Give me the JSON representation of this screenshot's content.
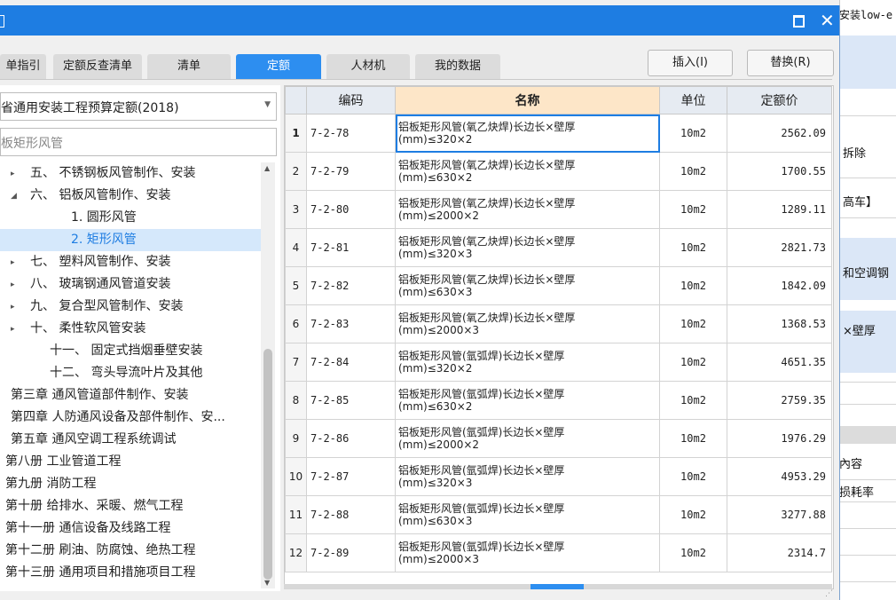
{
  "background": {
    "right_texts": [
      "安装low-e",
      "拆除",
      "高车】",
      "和空调钢",
      "×壁厚",
      "內容",
      "损耗率"
    ]
  },
  "dialog": {
    "tabs": [
      {
        "label": "单指引"
      },
      {
        "label": "定额反查清单"
      },
      {
        "label": "清单"
      },
      {
        "label": "定额"
      },
      {
        "label": "人材机"
      },
      {
        "label": "我的数据"
      }
    ],
    "insert_button": "插入(I)",
    "replace_button": "替换(R)",
    "library_selected": "省通用安装工程预算定额(2018)",
    "search_value": "板矩形风管",
    "tree": [
      {
        "label": "五、 不锈钢板风管制作、安装",
        "caret": "▸",
        "indent": 34
      },
      {
        "label": "六、 铝板风管制作、安装",
        "caret": "◢",
        "indent": 34
      },
      {
        "label": "1. 圆形风管",
        "caret": "",
        "indent": 80
      },
      {
        "label": "2. 矩形风管",
        "caret": "",
        "indent": 80,
        "selected": true
      },
      {
        "label": "七、 塑料风管制作、安装",
        "caret": "▸",
        "indent": 34
      },
      {
        "label": "八、 玻璃钢通风管道安装",
        "caret": "▸",
        "indent": 34
      },
      {
        "label": "九、 复合型风管制作、安装",
        "caret": "▸",
        "indent": 34
      },
      {
        "label": "十、 柔性软风管安装",
        "caret": "▸",
        "indent": 34
      },
      {
        "label": "十一、 固定式挡烟垂壁安装",
        "caret": "",
        "indent": 56
      },
      {
        "label": "十二、 弯头导流叶片及其他",
        "caret": "",
        "indent": 56
      },
      {
        "label": "第三章 通风管道部件制作、安装",
        "caret": "▸",
        "indent": 12
      },
      {
        "label": "第四章 人防通风设备及部件制作、安...",
        "caret": "▸",
        "indent": 12
      },
      {
        "label": "第五章 通风空调工程系统调试",
        "caret": "▸",
        "indent": 12
      },
      {
        "label": "第八册 工业管道工程",
        "caret": "",
        "indent": 6
      },
      {
        "label": "第九册 消防工程",
        "caret": "",
        "indent": 6
      },
      {
        "label": "第十册 给排水、采暖、燃气工程",
        "caret": "",
        "indent": 6
      },
      {
        "label": "第十一册 通信设备及线路工程",
        "caret": "",
        "indent": 6
      },
      {
        "label": "第十二册 刷油、防腐蚀、绝热工程",
        "caret": "",
        "indent": 6
      },
      {
        "label": "第十三册 通用项目和措施项目工程",
        "caret": "",
        "indent": 6
      }
    ],
    "grid": {
      "headers": {
        "code": "编码",
        "name": "名称",
        "unit": "单位",
        "price": "定额价"
      },
      "rows": [
        {
          "no": "1",
          "code": "7-2-78",
          "name1": "铝板矩形风管(氧乙炔焊)长边长×壁厚",
          "name2": "(mm)≤320×2",
          "unit": "10m2",
          "price": "2562.09"
        },
        {
          "no": "2",
          "code": "7-2-79",
          "name1": "铝板矩形风管(氧乙炔焊)长边长×壁厚",
          "name2": "(mm)≤630×2",
          "unit": "10m2",
          "price": "1700.55"
        },
        {
          "no": "3",
          "code": "7-2-80",
          "name1": "铝板矩形风管(氧乙炔焊)长边长×壁厚",
          "name2": "(mm)≤2000×2",
          "unit": "10m2",
          "price": "1289.11"
        },
        {
          "no": "4",
          "code": "7-2-81",
          "name1": "铝板矩形风管(氧乙炔焊)长边长×壁厚",
          "name2": "(mm)≤320×3",
          "unit": "10m2",
          "price": "2821.73"
        },
        {
          "no": "5",
          "code": "7-2-82",
          "name1": "铝板矩形风管(氧乙炔焊)长边长×壁厚",
          "name2": "(mm)≤630×3",
          "unit": "10m2",
          "price": "1842.09"
        },
        {
          "no": "6",
          "code": "7-2-83",
          "name1": "铝板矩形风管(氧乙炔焊)长边长×壁厚",
          "name2": "(mm)≤2000×3",
          "unit": "10m2",
          "price": "1368.53"
        },
        {
          "no": "7",
          "code": "7-2-84",
          "name1": "铝板矩形风管(氩弧焊)长边长×壁厚",
          "name2": "(mm)≤320×2",
          "unit": "10m2",
          "price": "4651.35"
        },
        {
          "no": "8",
          "code": "7-2-85",
          "name1": "铝板矩形风管(氩弧焊)长边长×壁厚",
          "name2": "(mm)≤630×2",
          "unit": "10m2",
          "price": "2759.35"
        },
        {
          "no": "9",
          "code": "7-2-86",
          "name1": "铝板矩形风管(氩弧焊)长边长×壁厚",
          "name2": "(mm)≤2000×2",
          "unit": "10m2",
          "price": "1976.29"
        },
        {
          "no": "10",
          "code": "7-2-87",
          "name1": "铝板矩形风管(氩弧焊)长边长×壁厚",
          "name2": "(mm)≤320×3",
          "unit": "10m2",
          "price": "4953.29"
        },
        {
          "no": "11",
          "code": "7-2-88",
          "name1": "铝板矩形风管(氩弧焊)长边长×壁厚",
          "name2": "(mm)≤630×3",
          "unit": "10m2",
          "price": "3277.88"
        },
        {
          "no": "12",
          "code": "7-2-89",
          "name1": "铝板矩形风管(氩弧焊)长边长×壁厚",
          "name2": "(mm)≤2000×3",
          "unit": "10m2",
          "price": "2314.7"
        }
      ]
    }
  },
  "colors": {
    "accent": "#1e7de2",
    "tab_active": "#2d8ef0",
    "header_name": "#fde6c8",
    "selected_tree": "#d5e8fb"
  },
  "icons": {
    "maximize": "maximize-icon",
    "close": "close-icon",
    "dropdown": "chevron-down-icon"
  }
}
